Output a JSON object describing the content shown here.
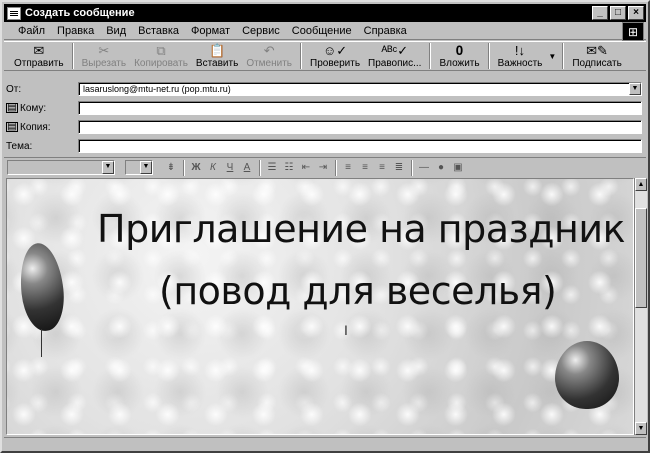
{
  "window": {
    "title": "Создать сообщение"
  },
  "menu": [
    "Файл",
    "Правка",
    "Вид",
    "Вставка",
    "Формат",
    "Сервис",
    "Сообщение",
    "Справка"
  ],
  "toolbar": {
    "send": "Отправить",
    "cut": "Вырезать",
    "copy": "Копировать",
    "paste": "Вставить",
    "undo": "Отменить",
    "check": "Проверить",
    "spelling": "Правопис...",
    "attach": "Вложить",
    "priority": "Важность",
    "sign": "Подписать"
  },
  "header": {
    "from_label": "От:",
    "from_value": "lasaruslong@mtu-net.ru    (pop.mtu.ru)",
    "to_label": "Кому:",
    "to_value": "",
    "cc_label": "Копия:",
    "cc_value": "",
    "subject_label": "Тема:",
    "subject_value": ""
  },
  "formatting": {
    "bold": "Ж",
    "italic": "К",
    "underline": "Ч",
    "font_color": "A"
  },
  "message": {
    "line1": "Приглашение на праздник",
    "line2": "(повод для веселья)"
  },
  "icons": {
    "send": "send-icon",
    "cut": "scissors-icon",
    "copy": "copy-icon",
    "paste": "paste-icon",
    "undo": "undo-icon",
    "check": "check-names-icon",
    "spelling": "spelling-icon",
    "attach": "paperclip-icon",
    "priority": "priority-icon",
    "sign": "sign-icon"
  }
}
